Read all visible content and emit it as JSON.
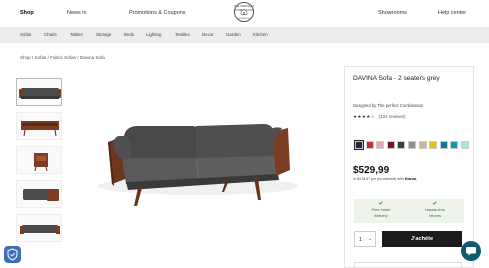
{
  "nav": {
    "items": [
      {
        "label": "Shop",
        "active": true
      },
      {
        "label": "News in",
        "active": false
      },
      {
        "label": "Promotions & Coupons",
        "active": false
      },
      {
        "label": "Showrooms",
        "active": false
      },
      {
        "label": "Help center",
        "active": false
      }
    ],
    "logo": {
      "arc_text": "THE PERFECT COMBINATION",
      "sub_text": "COMBINATION"
    }
  },
  "categories": [
    "Sofas",
    "Chairs",
    "Tables",
    "Storage",
    "Beds",
    "Lighting",
    "Textiles",
    "Decor",
    "Garden",
    "Kitchen"
  ],
  "breadcrumb": "Shop  /  Sofas  /  Fabric Sofas  /  Davina Sofa",
  "product": {
    "title": "DAVINA Sofa - 2 seaters grey",
    "designed_by": "Designed by The perfect Combination",
    "stars": "★★★★☆",
    "rating_value": 4.5,
    "reviews": "(131 reviews)",
    "price": "$529,99",
    "installments_prefix": "or $176.67 pm (no interest) with",
    "installments_brand": "Klarna.",
    "swatches": [
      "#1d2a44",
      "#b8353b",
      "#e9a9b4",
      "#7a1522",
      "#3e3e3e",
      "#8d8e8e",
      "#c7b99f",
      "#e3c21b",
      "#10798d",
      "#1199a7",
      "#a8e3dd"
    ],
    "selected_swatch": 0,
    "benefits": [
      {
        "line1": "Free home",
        "line2": "delivery"
      },
      {
        "line1": "Hassle-free",
        "line2": "returns"
      }
    ],
    "quantity": "1",
    "buy_label": "J'achète"
  },
  "colors": {
    "wood": "#7a3d22",
    "fabric": "#4a4a4c",
    "benefit_green": "#2f7a2f",
    "chat": "#0f5b6e",
    "shield": "#3d6fb6"
  }
}
